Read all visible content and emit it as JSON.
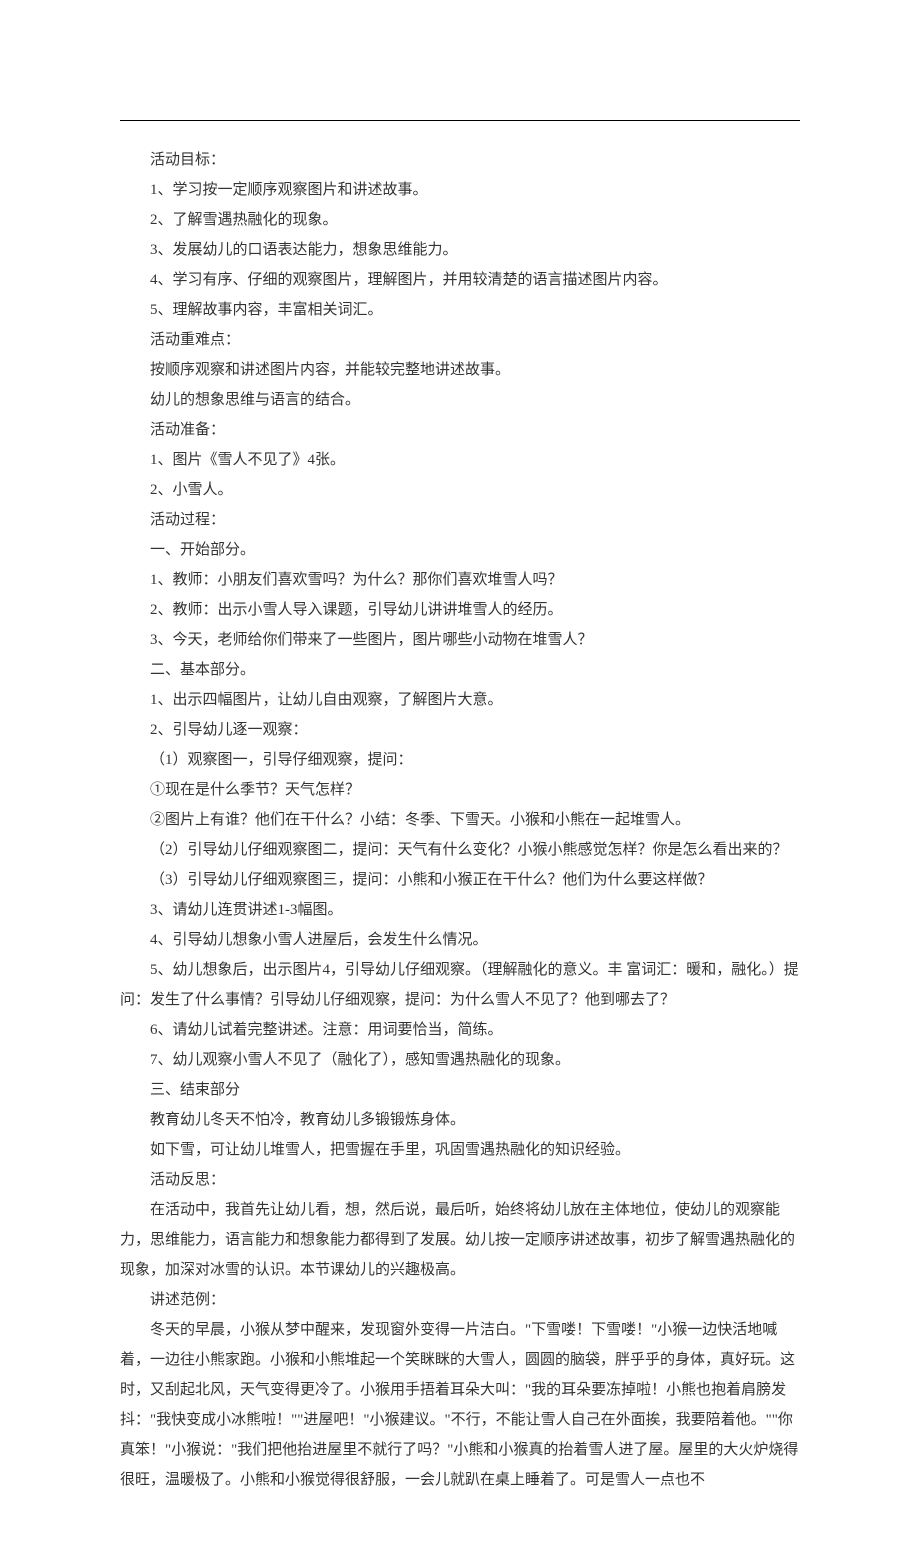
{
  "lines": [
    "活动目标：",
    "1、学习按一定顺序观察图片和讲述故事。",
    "2、了解雪遇热融化的现象。",
    "3、发展幼儿的口语表达能力，想象思维能力。",
    "4、学习有序、仔细的观察图片，理解图片，并用较清楚的语言描述图片内容。",
    "5、理解故事内容，丰富相关词汇。",
    "活动重难点：",
    "按顺序观察和讲述图片内容，并能较完整地讲述故事。",
    "幼儿的想象思维与语言的结合。",
    "活动准备：",
    "1、图片《雪人不见了》4张。",
    "2、小雪人。",
    "活动过程：",
    "一、开始部分。",
    "1、教师：小朋友们喜欢雪吗？为什么？那你们喜欢堆雪人吗？",
    "2、教师：出示小雪人导入课题，引导幼儿讲讲堆雪人的经历。",
    "3、今天，老师给你们带来了一些图片，图片哪些小动物在堆雪人？",
    "二、基本部分。",
    "1、出示四幅图片，让幼儿自由观察，了解图片大意。",
    "2、引导幼儿逐一观察：",
    "（1）观察图一，引导仔细观察，提问：",
    "①现在是什么季节？天气怎样？",
    " ②图片上有谁？他们在干什么？小结：冬季、下雪天。小猴和小熊在一起堆雪人。",
    "（2）引导幼儿仔细观察图二，提问：天气有什么变化？小猴小熊感觉怎样？你是怎么看出来的？",
    "（3）引导幼儿仔细观察图三，提问：小熊和小猴正在干什么？他们为什么要这样做？",
    "3、请幼儿连贯讲述1-3幅图。",
    "4、引导幼儿想象小雪人进屋后，会发生什么情况。",
    "5、幼儿想象后，出示图片4，引导幼儿仔细观察。（理解融化的意义。丰 富词汇：暖和，融化。）提问：发生了什么事情？引导幼儿仔细观察，提问：为什么雪人不见了？他到哪去了？",
    "6、请幼儿试着完整讲述。注意：用词要恰当，简练。",
    "7、幼儿观察小雪人不见了（融化了），感知雪遇热融化的现象。",
    "三、结束部分",
    "教育幼儿冬天不怕冷，教育幼儿多锻锻炼身体。",
    "如下雪，可让幼儿堆雪人，把雪握在手里，巩固雪遇热融化的知识经验。",
    "活动反思：",
    "在活动中，我首先让幼儿看，想，然后说，最后听，始终将幼儿放在主体地位，使幼儿的观察能力，思维能力，语言能力和想象能力都得到了发展。幼儿按一定顺序讲述故事，初步了解雪遇热融化的现象，加深对冰雪的认识。本节课幼儿的兴趣极高。",
    "讲述范例：",
    "冬天的早晨，小猴从梦中醒来，发现窗外变得一片洁白。\"下雪喽！下雪喽！\"小猴一边快活地喊着，一边往小熊家跑。小猴和小熊堆起一个笑眯眯的大雪人，圆圆的脑袋，胖乎乎的身体，真好玩。这时，又刮起北风，天气变得更冷了。小猴用手捂着耳朵大叫：\"我的耳朵要冻掉啦！小熊也抱着肩膀发抖：\"我快变成小冰熊啦！\"\"进屋吧！\"小猴建议。\"不行，不能让雪人自己在外面挨，我要陪着他。\"\"你真笨！\"小猴说：\"我们把他抬进屋里不就行了吗？\"小熊和小猴真的抬着雪人进了屋。屋里的大火炉烧得很旺，温暖极了。小熊和小猴觉得很舒服，一会儿就趴在桌上睡着了。可是雪人一点也不"
  ],
  "multiline_indices": [
    27,
    34,
    36
  ]
}
